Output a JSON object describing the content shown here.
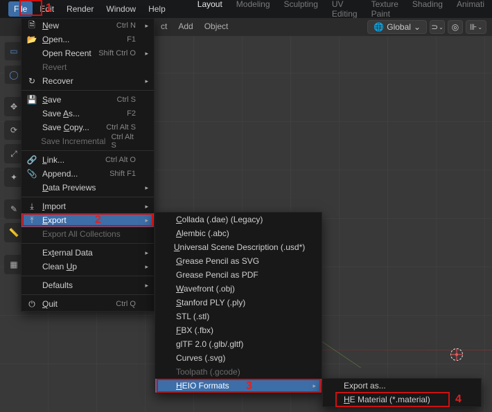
{
  "menubar": {
    "items": [
      "File",
      "Edit",
      "Render",
      "Window",
      "Help"
    ],
    "active_index": 0
  },
  "tabs": {
    "items": [
      "Layout",
      "Modeling",
      "Sculpting",
      "UV Editing",
      "Texture Paint",
      "Shading",
      "Animati"
    ],
    "active_index": 0
  },
  "toolbar": {
    "after_menu_labels": [
      "ct",
      "Add",
      "Object"
    ],
    "global_label": "Global",
    "global_chevron": "⌄"
  },
  "file_menu": [
    {
      "icon": "file-icon",
      "label": "New",
      "shortcut": "Ctrl N",
      "arrow": true,
      "underline": "N"
    },
    {
      "icon": "folder-icon",
      "label": "Open...",
      "shortcut": "",
      "underline": "O"
    },
    {
      "icon": "",
      "label": "Open Recent",
      "shortcut": "Shift Ctrl O",
      "arrow": true
    },
    {
      "icon": "",
      "label": "Revert",
      "disabled": true
    },
    {
      "icon": "history-icon",
      "label": "Recover",
      "arrow": true
    },
    {
      "sep": true
    },
    {
      "icon": "disk-icon",
      "label": "Save",
      "shortcut": "Ctrl S",
      "underline": "S"
    },
    {
      "icon": "",
      "label": "Save As...",
      "shortcut": "",
      "underline": "A"
    },
    {
      "icon": "",
      "label": "Save Copy...",
      "shortcut": "Ctrl Alt S",
      "underline": "C"
    },
    {
      "icon": "",
      "label": "Save Incremental",
      "shortcut": "Ctrl Alt S",
      "disabled": true
    },
    {
      "sep": true
    },
    {
      "icon": "link-icon",
      "label": "Link...",
      "shortcut": "Ctrl Alt O",
      "underline": "L"
    },
    {
      "icon": "append-icon",
      "label": "Append...",
      "shortcut": "Shift F1"
    },
    {
      "icon": "",
      "label": "Data Previews",
      "arrow": true,
      "underline": "D"
    },
    {
      "sep": true
    },
    {
      "icon": "import-icon",
      "label": "Import",
      "arrow": true,
      "underline": "I"
    },
    {
      "icon": "export-icon",
      "label": "Export",
      "arrow": true,
      "underline": "E",
      "highlight": true
    },
    {
      "icon": "",
      "label": "Export All Collections",
      "disabled": true
    },
    {
      "sep": true
    },
    {
      "icon": "",
      "label": "External Data",
      "arrow": true,
      "underline": "t"
    },
    {
      "icon": "",
      "label": "Clean Up",
      "arrow": true,
      "underline": "U"
    },
    {
      "sep": true
    },
    {
      "icon": "",
      "label": "Defaults",
      "arrow": true
    },
    {
      "sep": true
    },
    {
      "icon": "power-icon",
      "label": "Quit",
      "shortcut": "Ctrl Q",
      "underline": "Q"
    }
  ],
  "export_menu": [
    {
      "label": "Collada (.dae) (Legacy)",
      "underline": "C"
    },
    {
      "label": "Alembic (.abc)",
      "underline": "A"
    },
    {
      "label": "Universal Scene Description (.usd*)",
      "underline": "U"
    },
    {
      "label": "Grease Pencil as SVG",
      "underline": "G"
    },
    {
      "label": "Grease Pencil as PDF"
    },
    {
      "label": "Wavefront (.obj)",
      "underline": "W"
    },
    {
      "label": "Stanford PLY (.ply)",
      "underline": "S"
    },
    {
      "label": "STL (.stl)"
    },
    {
      "label": "FBX (.fbx)",
      "underline": "F"
    },
    {
      "label": "glTF 2.0 (.glb/.gltf)"
    },
    {
      "label": "Curves (.svg)"
    },
    {
      "label": "Toolpath (.gcode)",
      "disabled": true
    },
    {
      "label": "HEIO Formats",
      "arrow": true,
      "highlight": true,
      "underline": "H"
    }
  ],
  "heio_menu": [
    {
      "label": "Export as..."
    },
    {
      "label": "HE Material (*.material)",
      "underline": "H",
      "boxed": true
    }
  ],
  "annotations": {
    "n1": "1",
    "n2": "2",
    "n3": "3",
    "n4": "4"
  },
  "icons": {
    "file": "🗎",
    "folder": "📂",
    "history": "↻",
    "disk": "💾",
    "link": "🔗",
    "append": "📎",
    "import": "⤓",
    "export": "⤒",
    "power": "⏻",
    "chevron_right": "▸",
    "chevron_down": "⌄",
    "magnet": "⊃",
    "overlap": "◎"
  }
}
